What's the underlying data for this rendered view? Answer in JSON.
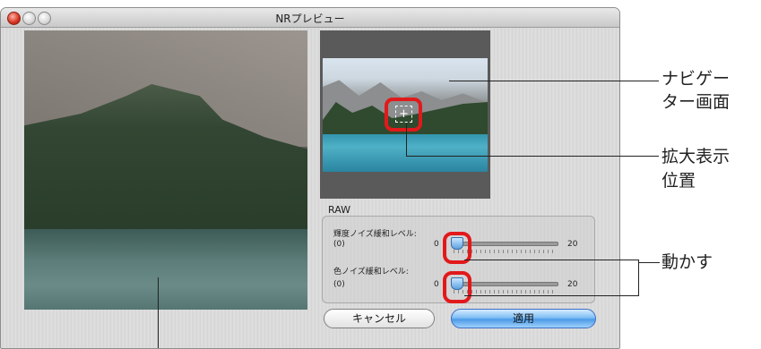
{
  "window": {
    "title": "NRプレビュー"
  },
  "raw_group": {
    "label": "RAW",
    "luminance": {
      "label": "輝度ノイズ緩和レベル:",
      "left_value": "(0)",
      "slider_min": "0",
      "slider_max": "20",
      "value": 0
    },
    "color": {
      "label": "色ノイズ緩和レベル:",
      "left_value": "(0)",
      "slider_min": "0",
      "slider_max": "20",
      "value": 0
    }
  },
  "buttons": {
    "cancel": "キャンセル",
    "apply": "適用"
  },
  "annotations": {
    "navigator_line1": "ナビゲー",
    "navigator_line2": "ター画面",
    "zoom_line1": "拡大表示",
    "zoom_line2": "位置",
    "move": "動かす"
  },
  "colors": {
    "highlight_ring": "#e2191b",
    "apply_button": "#4c9ae8"
  }
}
